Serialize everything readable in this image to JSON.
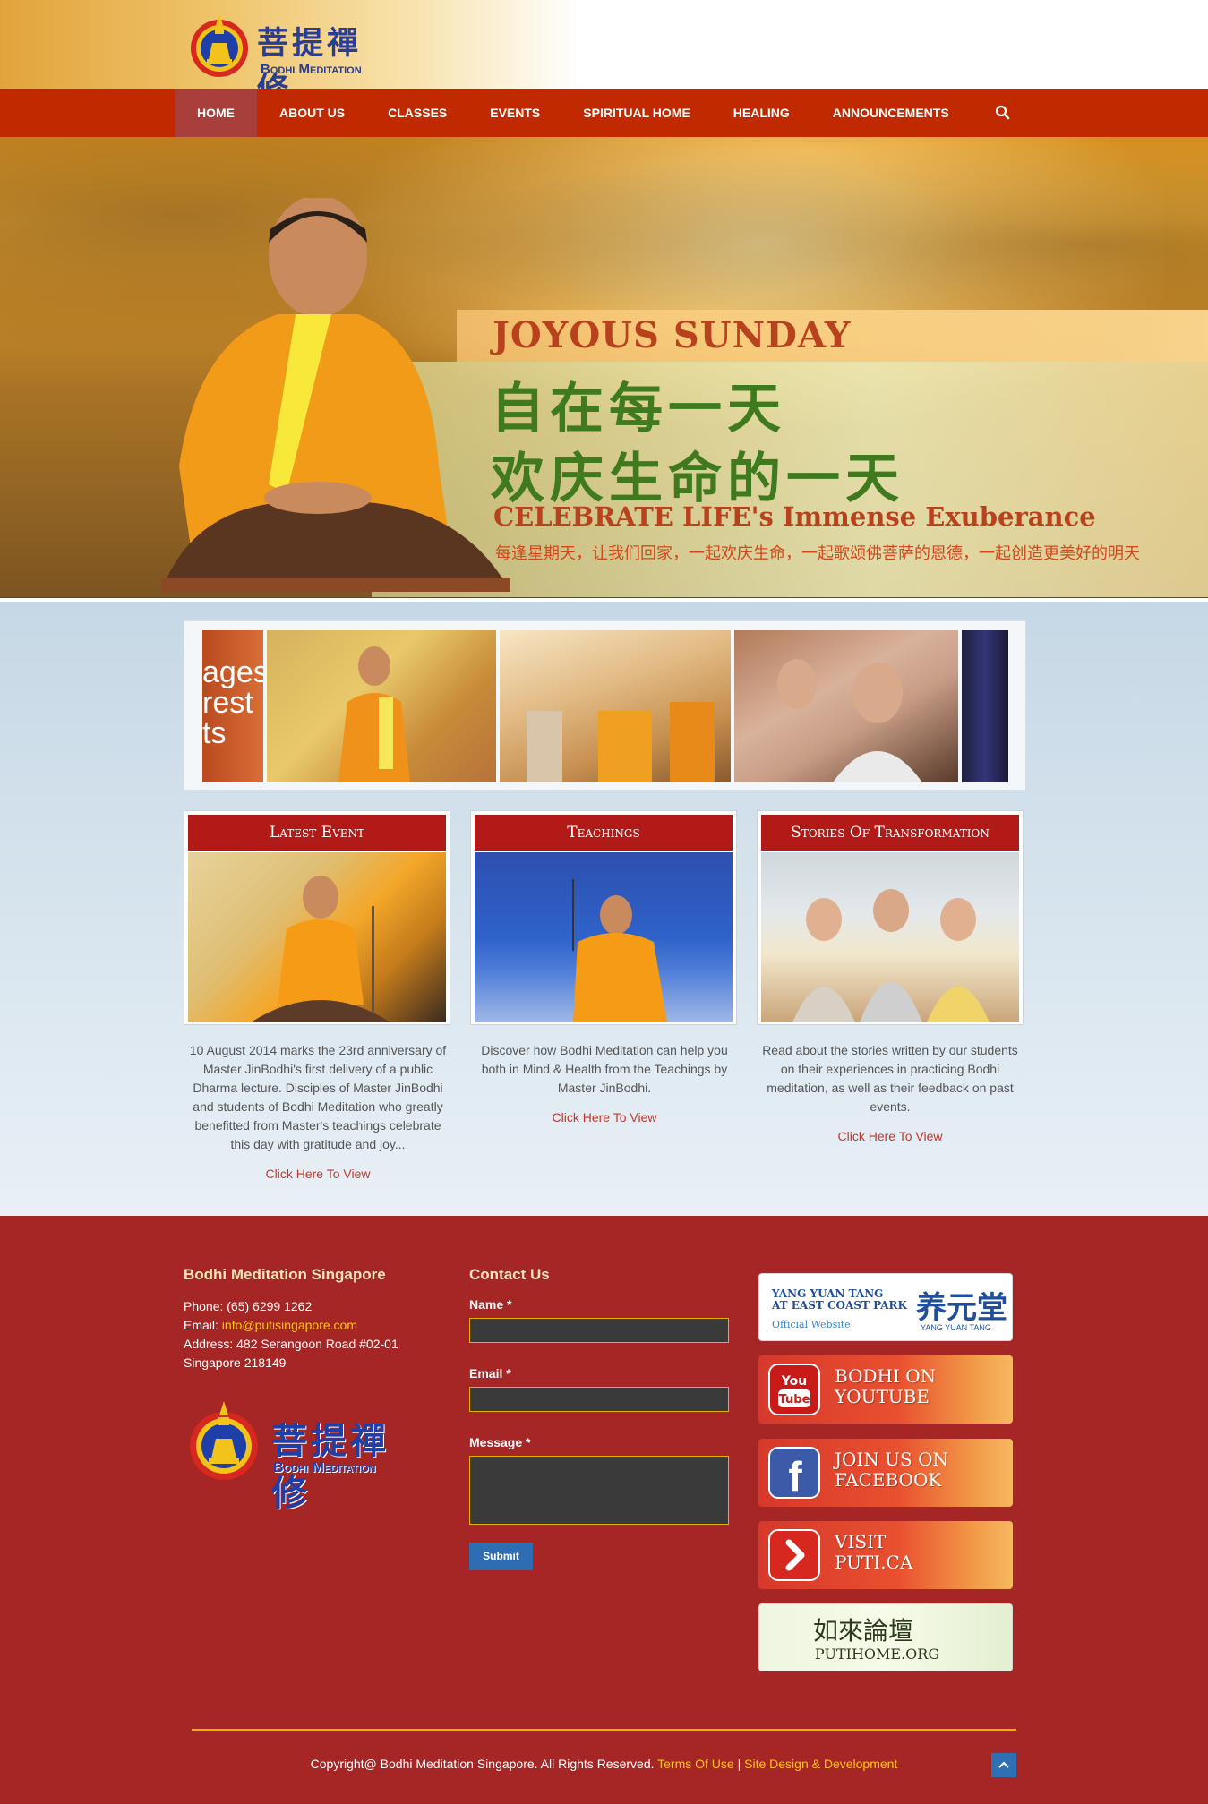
{
  "header": {
    "logo_cn": "菩提禪修",
    "logo_en": "Bodhi Meditation"
  },
  "nav": {
    "items": [
      {
        "label": "HOME",
        "active": true
      },
      {
        "label": "ABOUT US"
      },
      {
        "label": "CLASSES"
      },
      {
        "label": "EVENTS"
      },
      {
        "label": "SPIRITUAL HOME"
      },
      {
        "label": "HEALING"
      },
      {
        "label": "ANNOUNCEMENTS"
      }
    ],
    "search_icon": "search-icon"
  },
  "hero": {
    "title": "JOYOUS SUNDAY",
    "cn_line1": "自在每一天",
    "cn_line2": "欢庆生命的一天",
    "subtitle": "CELEBRATE LIFE's Immense Exuberance",
    "cn_caption": "每逢星期天，让我们回家，一起欢庆生命，一起歌颂佛菩萨的恩德，一起创造更美好的明天"
  },
  "gallery": {
    "partial_text": "ages\nrest\nts"
  },
  "cards": [
    {
      "title": "Latest Event",
      "text": "10 August 2014 marks the 23rd anniversary of Master JinBodhi's first delivery of a public Dharma lecture. Disciples of Master JinBodhi and students of Bodhi Meditation who greatly benefitted from Master's teachings celebrate this day with gratitude and joy...",
      "link": "Click Here To View"
    },
    {
      "title": "Teachings",
      "text": "Discover how Bodhi Meditation can help you both in Mind & Health from the Teachings by Master JinBodhi.",
      "link": "Click Here To View"
    },
    {
      "title": "Stories Of Transformation",
      "text": "Read about the stories written by our students on their experiences in practicing Bodhi meditation, as well as their feedback on past events.",
      "link": "Click Here To View"
    }
  ],
  "footer": {
    "org_heading": "Bodhi Meditation Singapore",
    "phone": "Phone: (65) 6299 1262",
    "email_label": "Email: ",
    "email": "info@putisingapore.com",
    "address1": "Address: 482 Serangoon Road #02-01",
    "address2": "Singapore 218149",
    "logo_cn": "菩提禪修",
    "logo_en": "Bodhi Meditation",
    "contact_heading": "Contact Us",
    "name_label": "Name *",
    "email_field_label": "Email *",
    "message_label": "Message *",
    "submit_label": "Submit",
    "banners": {
      "yyt_line1": "YANG YUAN TANG",
      "yyt_line2": "AT EAST COAST PARK",
      "yyt_line3": "Official Website",
      "yyt_cn": "养元堂",
      "yyt_small": "YANG YUAN TANG",
      "youtube": "BODHI ON\nYOUTUBE",
      "youtube_icon": "You\nTube",
      "facebook": "JOIN US ON\nFACEBOOK",
      "puti": "VISIT\nPUTI.CA",
      "putihome_cn": "如來論壇",
      "putihome": "PUTIHOME.ORG"
    },
    "copyright": "Copyright@ Bodhi Meditation Singapore. All Rights Reserved.",
    "terms": "Terms Of Use",
    "separator": "|",
    "design": "Site Design & Development"
  },
  "colors": {
    "nav_bg": "#c12a00",
    "nav_active": "#a93f3a",
    "card_title": "#b11a17",
    "footer_bg": "#a62525",
    "link": "#c0392b",
    "footer_link": "#ffc21a",
    "submit": "#2e6db1"
  }
}
